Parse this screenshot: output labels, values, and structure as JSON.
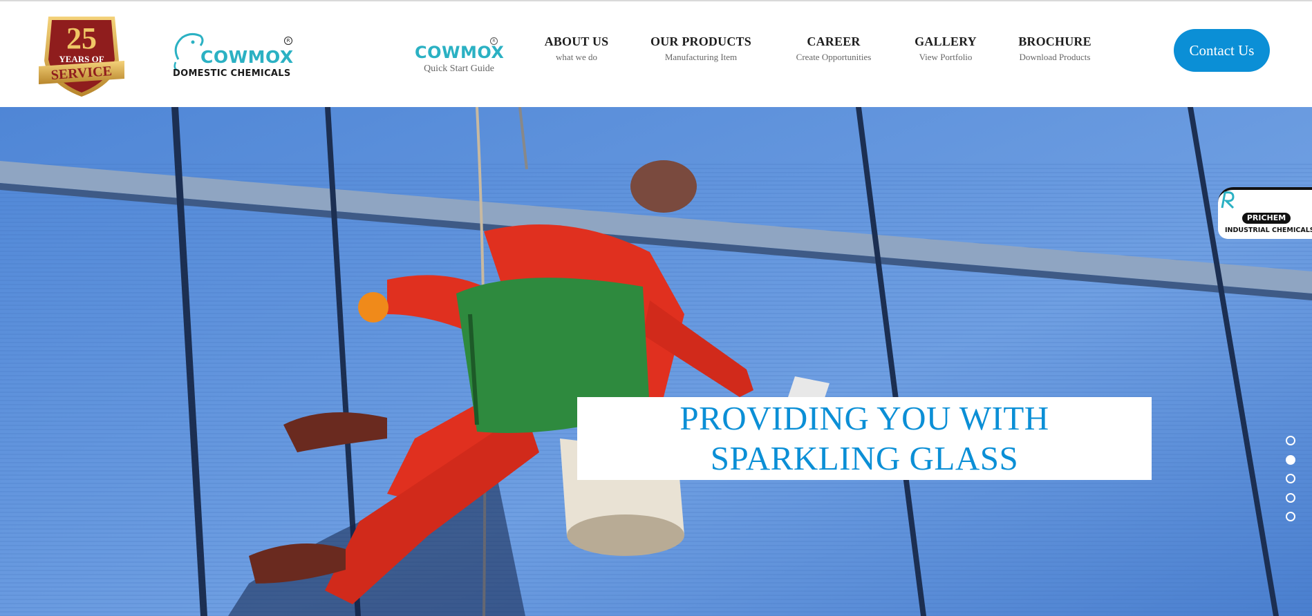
{
  "anniversary_badge": {
    "years": "25",
    "line1": "YEARS OF",
    "line2": "SERVICE",
    "icon": "anniversary-shield-badge"
  },
  "brand": {
    "name": "COWMOX",
    "subtitle": "DOMESTIC CHEMICALS",
    "registered_mark": "R"
  },
  "nav": {
    "cowmox": {
      "title": "COWMOX",
      "subtitle": "Quick Start Guide",
      "registered_mark": "R"
    },
    "items": [
      {
        "title": "ABOUT US",
        "subtitle": "what we do"
      },
      {
        "title": "OUR PRODUCTS",
        "subtitle": "Manufacturing Item"
      },
      {
        "title": "CAREER",
        "subtitle": "Create Opportunities"
      },
      {
        "title": "GALLERY",
        "subtitle": "View Portfolio"
      },
      {
        "title": "BROCHURE",
        "subtitle": "Download Products"
      }
    ],
    "contact_label": "Contact Us"
  },
  "hero": {
    "caption_line1": "PROVIDING YOU WITH",
    "caption_line2": "SPARKLING GLASS",
    "image": "window-cleaner-rappelling-glass-building",
    "slides": {
      "count": 5,
      "active_index": 1
    }
  },
  "side_tab": {
    "name": "PRICHEM",
    "subtitle": "INDUSTRIAL CHEMICALS",
    "icon": "prichem-logo-icon"
  },
  "colors": {
    "accent": "#0b8fd6",
    "brand_teal": "#2bb1c3",
    "badge_red": "#8f1d1d",
    "badge_gold": "#e6b54a"
  }
}
